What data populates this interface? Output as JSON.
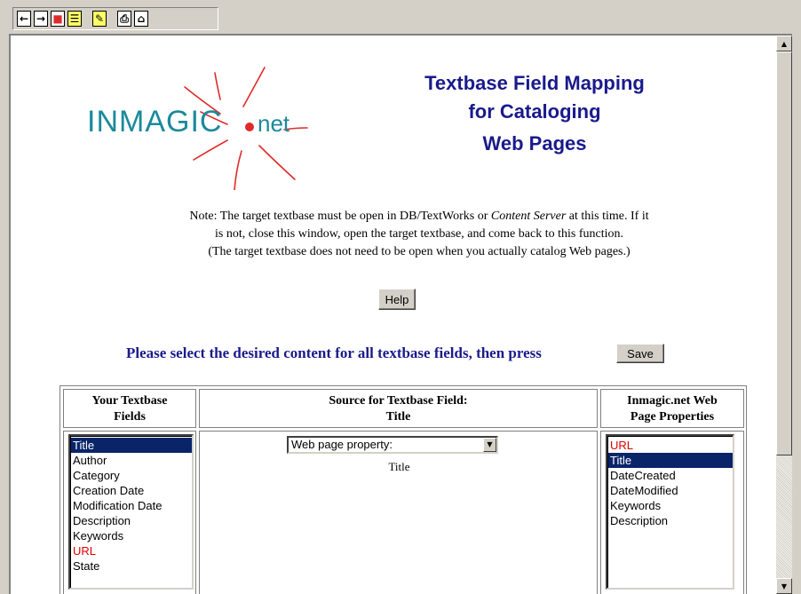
{
  "toolbar": {
    "buttons": [
      {
        "icon": "back-arrow-icon",
        "glyph": "←"
      },
      {
        "icon": "forward-arrow-icon",
        "glyph": "→"
      },
      {
        "icon": "stop-icon",
        "glyph": "■"
      },
      {
        "icon": "list-icon",
        "glyph": "☰"
      },
      {
        "icon": "edit-icon",
        "glyph": "✎"
      },
      {
        "icon": "print-icon",
        "glyph": "⎙"
      },
      {
        "icon": "home-icon",
        "glyph": "⌂"
      }
    ]
  },
  "logo": {
    "text": "INMAGIC",
    "suffix": "net"
  },
  "title": {
    "line1": "Textbase Field Mapping",
    "line2": "for Cataloging",
    "line3": "Web Pages"
  },
  "note": {
    "part1": "Note:  The target textbase must be open in DB/TextWorks or ",
    "em": "Content Server",
    "part2": " at this time.  If it",
    "line2": "is not, close this window, open the target textbase, and come back to this function.",
    "line3": "(The target textbase does not need to be open when you actually catalog Web pages.)"
  },
  "help_label": "Help",
  "prompt": "Please select the desired content for all textbase fields, then press",
  "save_label": "Save",
  "table": {
    "col1_header_line1": "Your Textbase",
    "col1_header_line2": "Fields",
    "col2_header_line1": "Source for Textbase Field:",
    "col2_header_line2": "Title",
    "col3_header_line1": "Inmagic.net Web",
    "col3_header_line2": "Page Properties",
    "fields": [
      {
        "label": "Title",
        "selected": true,
        "red": false
      },
      {
        "label": "Author",
        "selected": false,
        "red": false
      },
      {
        "label": "Category",
        "selected": false,
        "red": false
      },
      {
        "label": "Creation Date",
        "selected": false,
        "red": false
      },
      {
        "label": "Modification Date",
        "selected": false,
        "red": false
      },
      {
        "label": "Description",
        "selected": false,
        "red": false
      },
      {
        "label": "Keywords",
        "selected": false,
        "red": false
      },
      {
        "label": "URL",
        "selected": false,
        "red": true
      },
      {
        "label": "State",
        "selected": false,
        "red": false
      }
    ],
    "source_select_value": "Web page property:",
    "source_selected_property": "Title",
    "properties": [
      {
        "label": "URL",
        "selected": false,
        "red": true
      },
      {
        "label": "Title",
        "selected": true,
        "red": false
      },
      {
        "label": "DateCreated",
        "selected": false,
        "red": false
      },
      {
        "label": "DateModified",
        "selected": false,
        "red": false
      },
      {
        "label": "Keywords",
        "selected": false,
        "red": false
      },
      {
        "label": "Description",
        "selected": false,
        "red": false
      }
    ]
  },
  "colors": {
    "title_blue": "#1a1a8c",
    "logo_teal": "#1a8a9b",
    "logo_red": "#e02a2a",
    "selection": "#0a246a",
    "highlight_red": "#e00000"
  }
}
